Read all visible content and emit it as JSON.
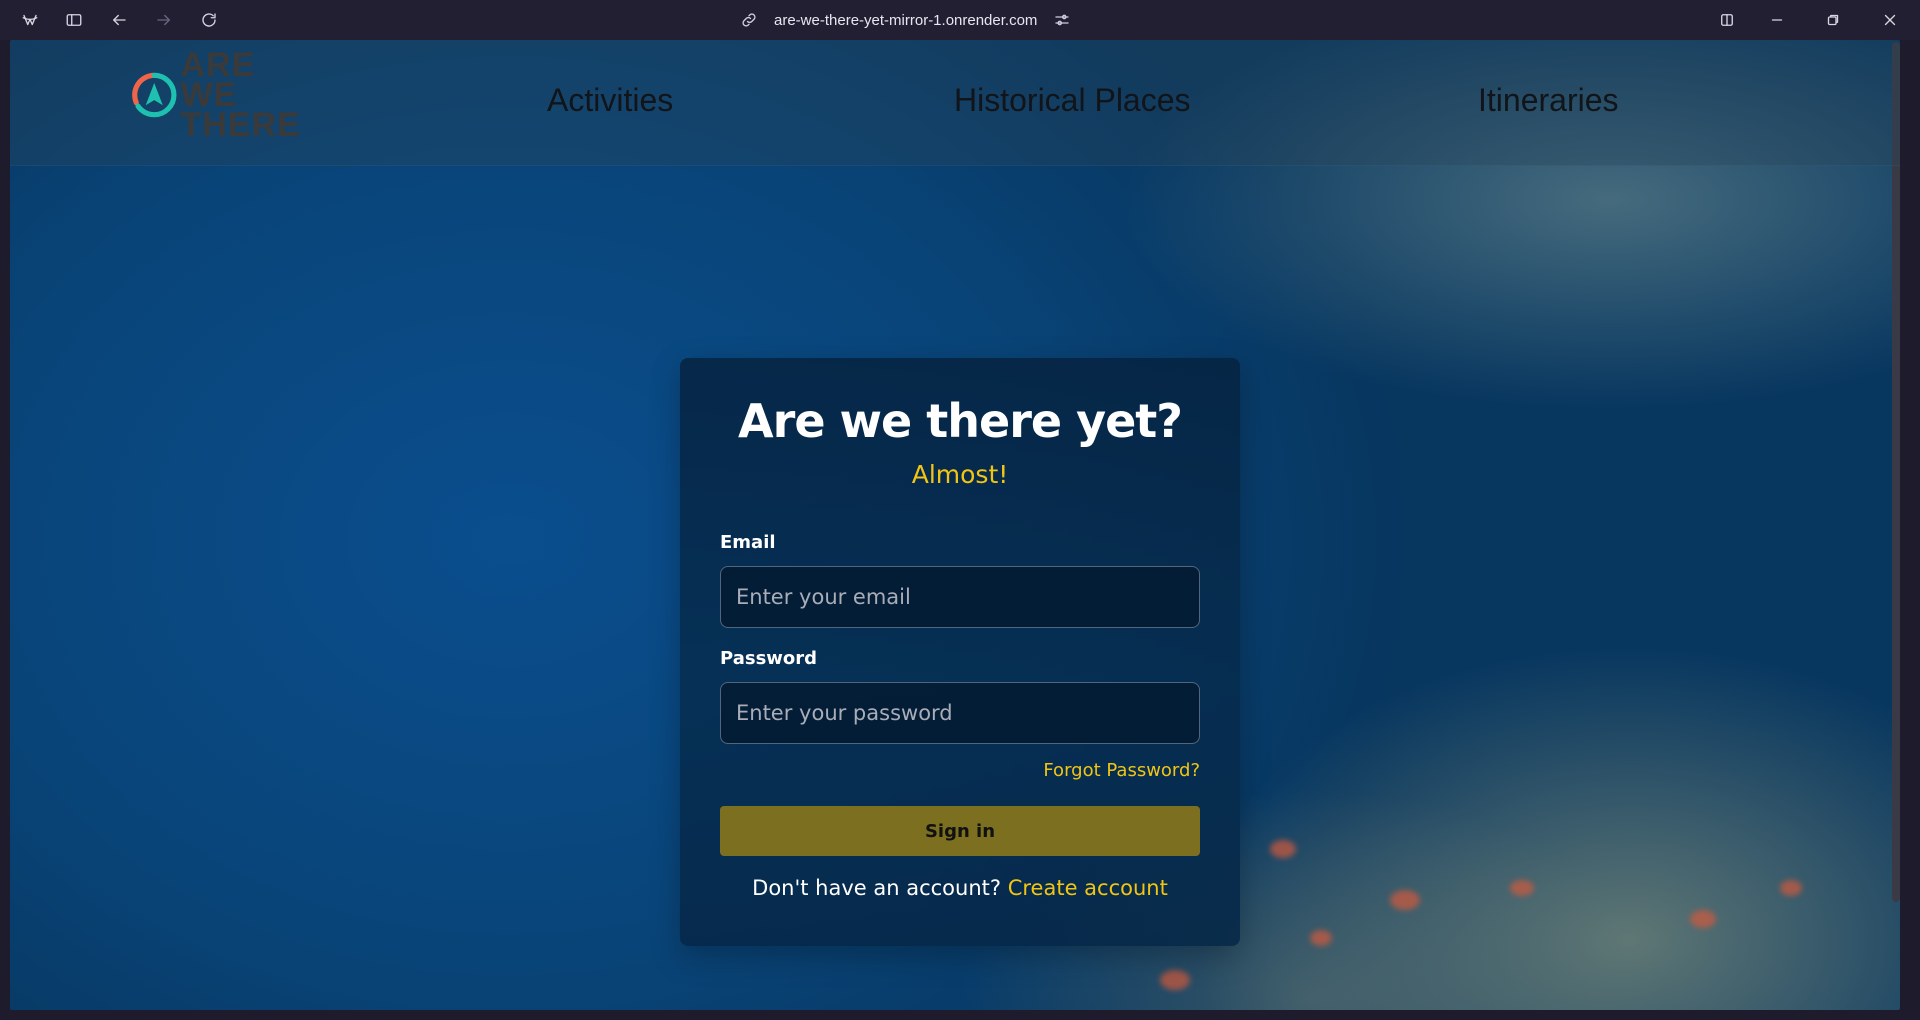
{
  "browser": {
    "url": "are-we-there-yet-mirror-1.onrender.com",
    "icons": [
      "app-logo-icon",
      "sidebar-icon",
      "back-icon",
      "forward-icon",
      "reload-icon",
      "link-icon",
      "site-settings-icon",
      "split-view-icon",
      "minimize-icon",
      "restore-icon",
      "close-icon"
    ]
  },
  "nav": {
    "logo_text_line1": "ARE WE",
    "logo_text_line2": "THERE",
    "links": [
      "Activities",
      "Historical Places",
      "Itineraries"
    ]
  },
  "login": {
    "title": "Are we there yet?",
    "subtitle": "Almost!",
    "email_label": "Email",
    "email_placeholder": "Enter your email",
    "email_value": "",
    "password_label": "Password",
    "password_placeholder": "Enter your password",
    "password_value": "",
    "forgot": "Forgot Password?",
    "signin": "Sign in",
    "no_account": "Don't have an account?",
    "create": "Create account"
  },
  "colors": {
    "accent": "#f2c514",
    "button": "#7c6f20",
    "logo_orange": "#f0654a",
    "logo_teal": "#1ec1b0"
  }
}
